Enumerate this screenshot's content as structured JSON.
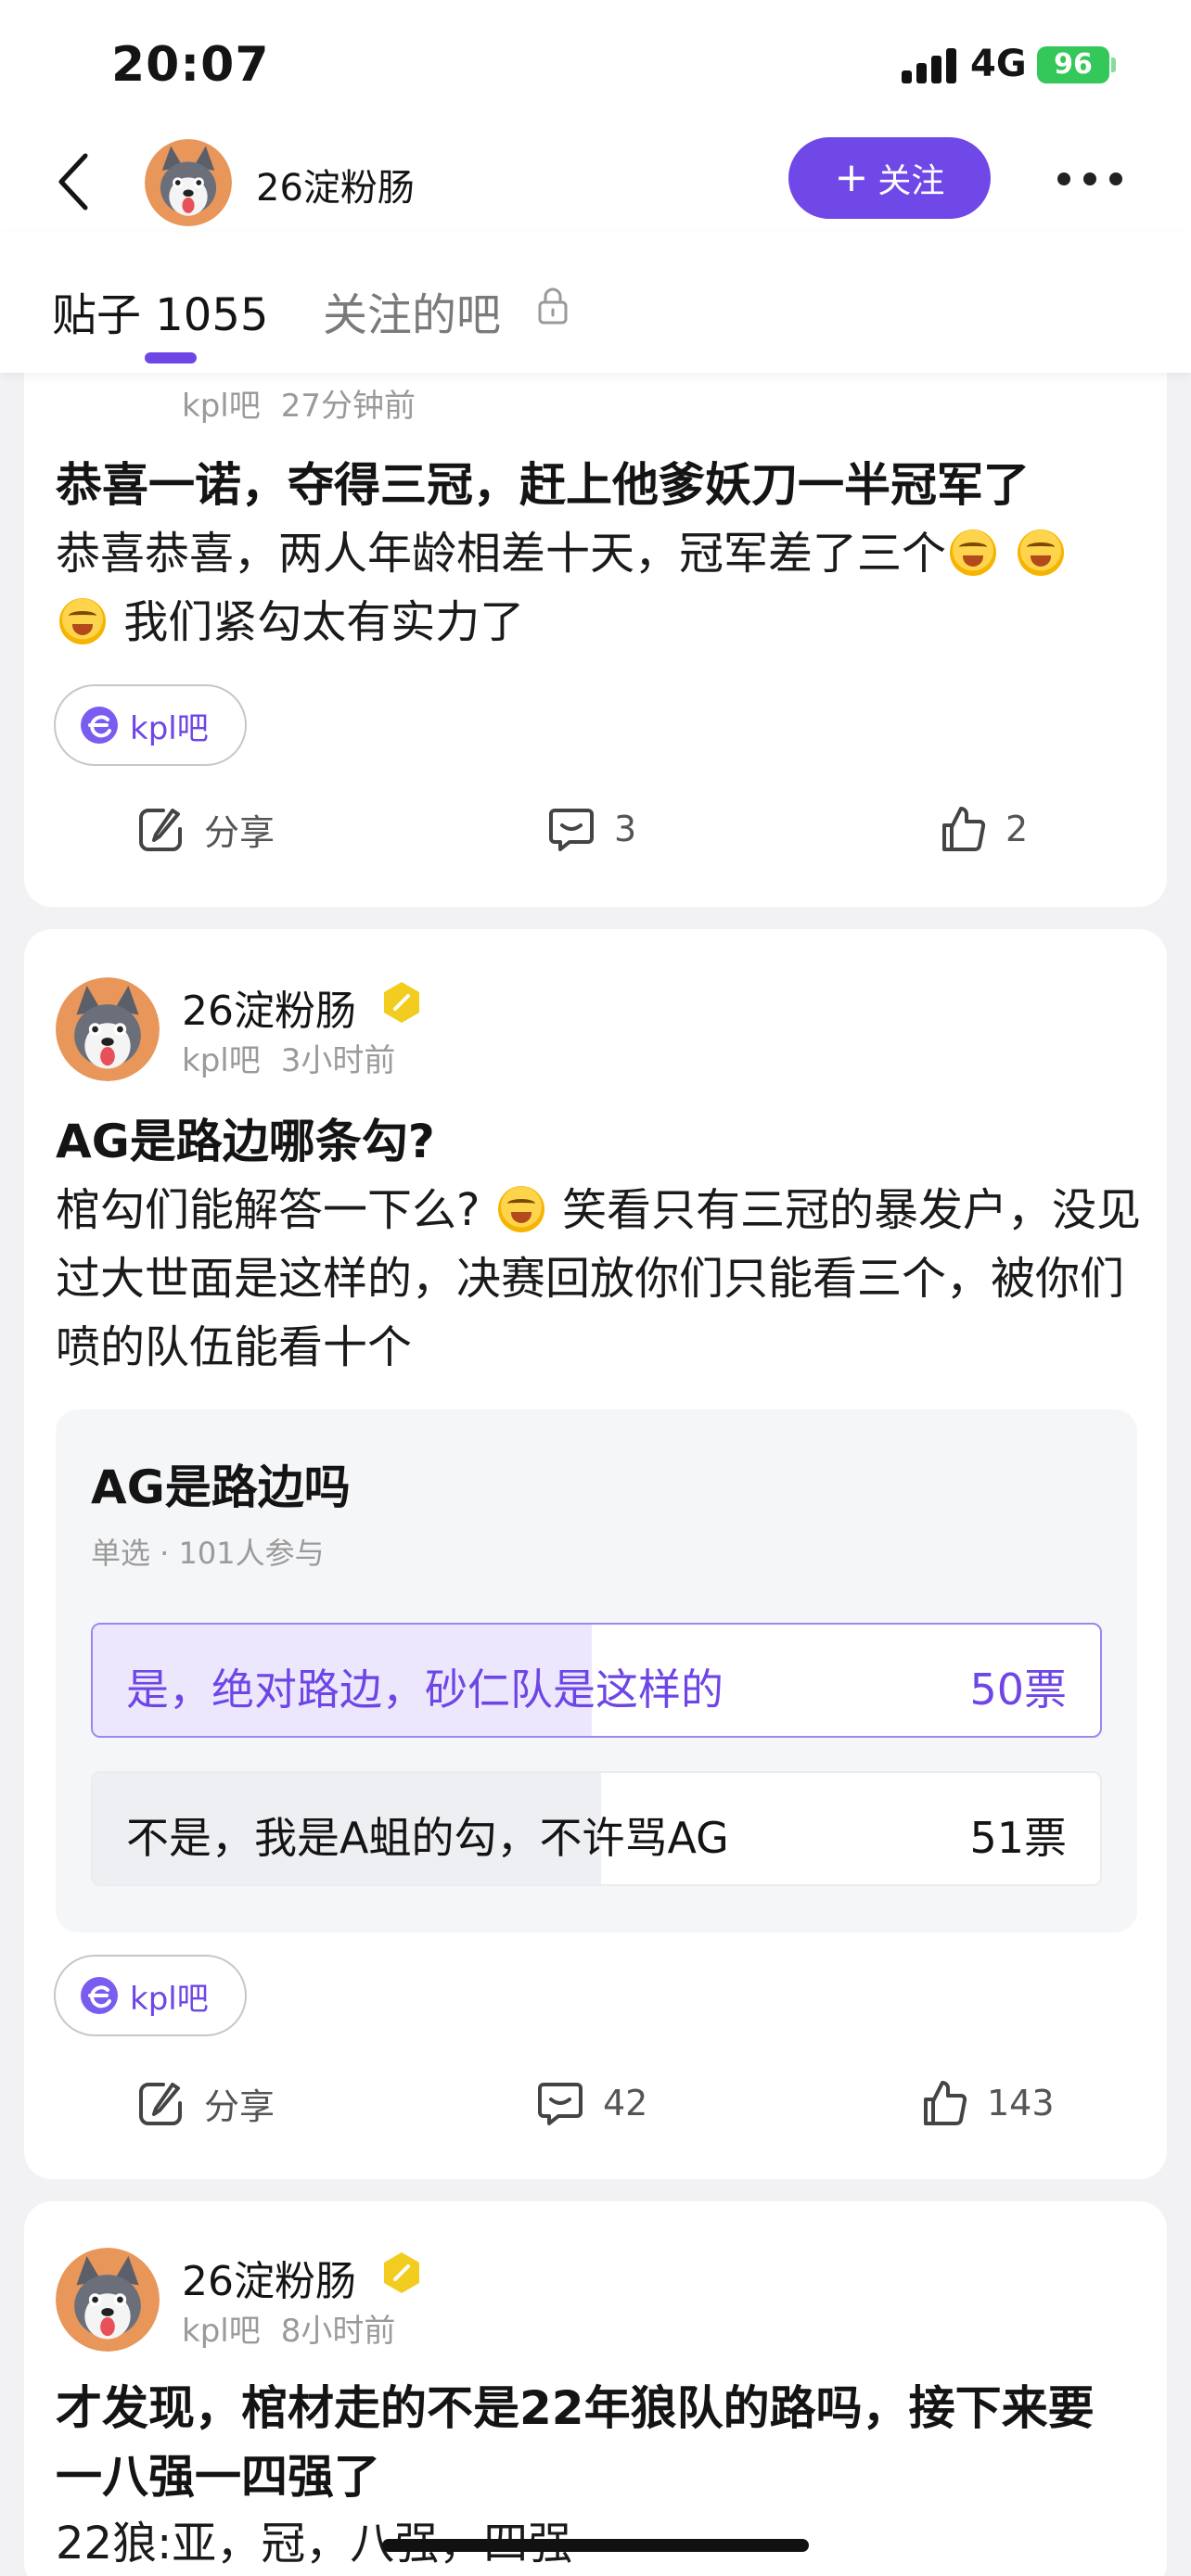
{
  "status_bar": {
    "time": "20:07",
    "network": "4G",
    "battery": "96"
  },
  "header": {
    "user_name": "26淀粉肠",
    "follow_label": "关注",
    "follow_plus": "+"
  },
  "tabs": [
    {
      "label": "贴子 1055",
      "active": true
    },
    {
      "label": "关注的吧",
      "active": false
    }
  ],
  "colors": {
    "accent": "#6e46e6",
    "battery": "#34c759"
  },
  "posts": [
    {
      "forum": "kpl吧",
      "time": "27分钟前",
      "title": "恭喜一诺，夺得三冠，赶上他爹妖刀一半冠军了",
      "body_1": "恭喜恭喜，两人年龄相差十天，冠军差了三个",
      "body_2": "我们紧勾太有实力了",
      "tag": "kpl吧",
      "share": "分享",
      "comments": "3",
      "likes": "2"
    },
    {
      "author": "26淀粉肠",
      "forum": "kpl吧",
      "time": "3小时前",
      "title": "AG是路边哪条勾?",
      "body_1": "棺勾们能解答一下么?",
      "body_2": "笑看只有三冠的暴发户，没见过大世面是这样的，决赛回放你们只能看三个，被你们喷的队伍能看十个",
      "poll": {
        "title": "AG是路边吗",
        "meta": "单选 · 101人参与",
        "options": [
          {
            "label": "是，绝对路边，砂仁队是这样的",
            "votes": "50票",
            "fraction": 0.495,
            "selected": true
          },
          {
            "label": "不是，我是A蛆的勾，不许骂AG",
            "votes": "51票",
            "fraction": 0.505,
            "selected": false
          }
        ]
      },
      "tag": "kpl吧",
      "share": "分享",
      "comments": "42",
      "likes": "143"
    },
    {
      "author": "26淀粉肠",
      "forum": "kpl吧",
      "time": "8小时前",
      "title": "才发现，棺材走的不是22年狼队的路吗，接下来要一八强一四强了",
      "body_1": "22狼:亚，冠，八强，四强"
    }
  ],
  "icons": [
    "back-icon",
    "more-icon",
    "lock-icon",
    "share-icon",
    "comment-icon",
    "like-icon",
    "kpl-tag-icon",
    "badge-icon"
  ]
}
